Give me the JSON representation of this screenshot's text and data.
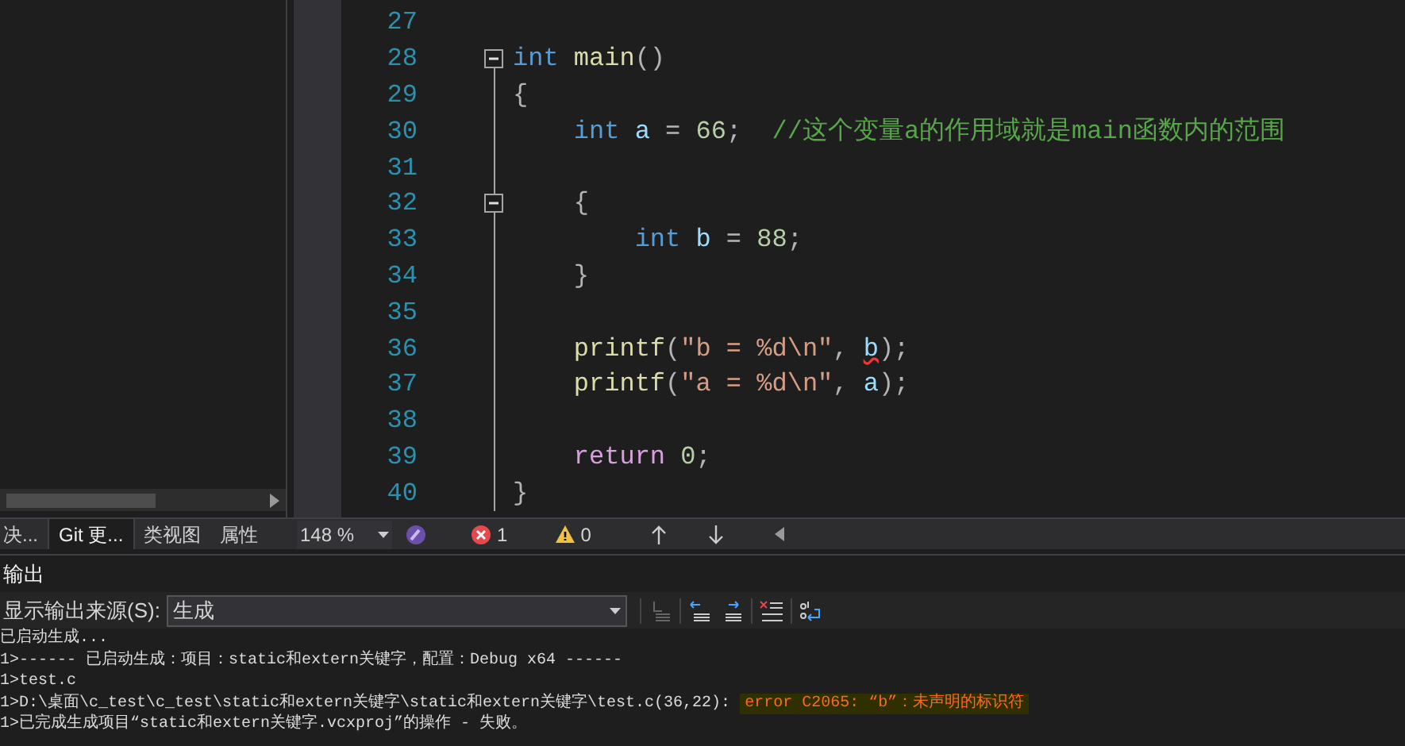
{
  "code_lines": [
    {
      "number": "27",
      "fold_toggle": false
    },
    {
      "number": "28",
      "fold_toggle": true,
      "tokens": [
        {
          "kind": "keyword",
          "text": "int"
        },
        {
          "kind": "function",
          "text": " main"
        },
        {
          "kind": "plain",
          "text": "()"
        }
      ]
    },
    {
      "number": "29",
      "fold_toggle": false,
      "tokens": [
        {
          "kind": "plain",
          "text": "{"
        }
      ]
    },
    {
      "number": "30",
      "fold_toggle": false,
      "tokens": [
        {
          "kind": "keyword",
          "text": "    int"
        },
        {
          "kind": "variable",
          "text": " a"
        },
        {
          "kind": "plain",
          "text": " = "
        },
        {
          "kind": "number",
          "text": "66"
        },
        {
          "kind": "plain",
          "text": ";  "
        },
        {
          "kind": "comment",
          "text": "//这个变量a的作用域就是main函数内的范围"
        }
      ]
    },
    {
      "number": "31",
      "fold_toggle": false
    },
    {
      "number": "32",
      "fold_toggle": true,
      "tokens": [
        {
          "kind": "plain",
          "text": "    {"
        }
      ]
    },
    {
      "number": "33",
      "fold_toggle": false,
      "tokens": [
        {
          "kind": "keyword",
          "text": "        int"
        },
        {
          "kind": "variable",
          "text": " b"
        },
        {
          "kind": "plain",
          "text": " = "
        },
        {
          "kind": "number",
          "text": "88"
        },
        {
          "kind": "plain",
          "text": ";"
        }
      ]
    },
    {
      "number": "34",
      "fold_toggle": false,
      "tokens": [
        {
          "kind": "plain",
          "text": "    }"
        }
      ]
    },
    {
      "number": "35",
      "fold_toggle": false
    },
    {
      "number": "36",
      "fold_toggle": false,
      "tokens": [
        {
          "kind": "function",
          "text": "    printf"
        },
        {
          "kind": "plain",
          "text": "("
        },
        {
          "kind": "string",
          "text": "\"b = %d\\n\""
        },
        {
          "kind": "plain",
          "text": ", "
        },
        {
          "kind": "error",
          "text": "b"
        },
        {
          "kind": "plain",
          "text": ");"
        }
      ]
    },
    {
      "number": "37",
      "fold_toggle": false,
      "tokens": [
        {
          "kind": "function",
          "text": "    printf"
        },
        {
          "kind": "plain",
          "text": "("
        },
        {
          "kind": "string",
          "text": "\"a = %d\\n\""
        },
        {
          "kind": "plain",
          "text": ", "
        },
        {
          "kind": "variable",
          "text": "a"
        },
        {
          "kind": "plain",
          "text": ");"
        }
      ]
    },
    {
      "number": "38",
      "fold_toggle": false
    },
    {
      "number": "39",
      "fold_toggle": false,
      "tokens": [
        {
          "kind": "control",
          "text": "    return"
        },
        {
          "kind": "number",
          "text": " 0"
        },
        {
          "kind": "plain",
          "text": ";"
        }
      ]
    },
    {
      "number": "40",
      "fold_toggle": false,
      "tokens": [
        {
          "kind": "plain",
          "text": "}"
        }
      ]
    }
  ],
  "tool_tabs": [
    {
      "label": "决...",
      "selected": false
    },
    {
      "label": "Git 更...",
      "selected": true
    },
    {
      "label": "类视图",
      "selected": false
    },
    {
      "label": "属性",
      "selected": false
    }
  ],
  "editor_status": {
    "zoom": "148 %",
    "errors": "1",
    "warnings": "0"
  },
  "output": {
    "title": "输出",
    "source_label": "显示输出来源(S):",
    "source": "生成",
    "lines": [
      {
        "text": "已启动生成..."
      },
      {
        "text": "1>------ 已启动生成：项目：static和extern关键字，配置：Debug x64 ------"
      },
      {
        "text": "1>test.c"
      },
      {
        "text": "1>D:\\桌面\\c_test\\c_test\\static和extern关键字\\static和extern关键字\\test.c(36,22): ",
        "error": "error C2065: “b”：未声明的标识符"
      },
      {
        "text": "1>已完成生成项目“static和extern关键字.vcxproj”的操作 - 失败。"
      }
    ]
  }
}
